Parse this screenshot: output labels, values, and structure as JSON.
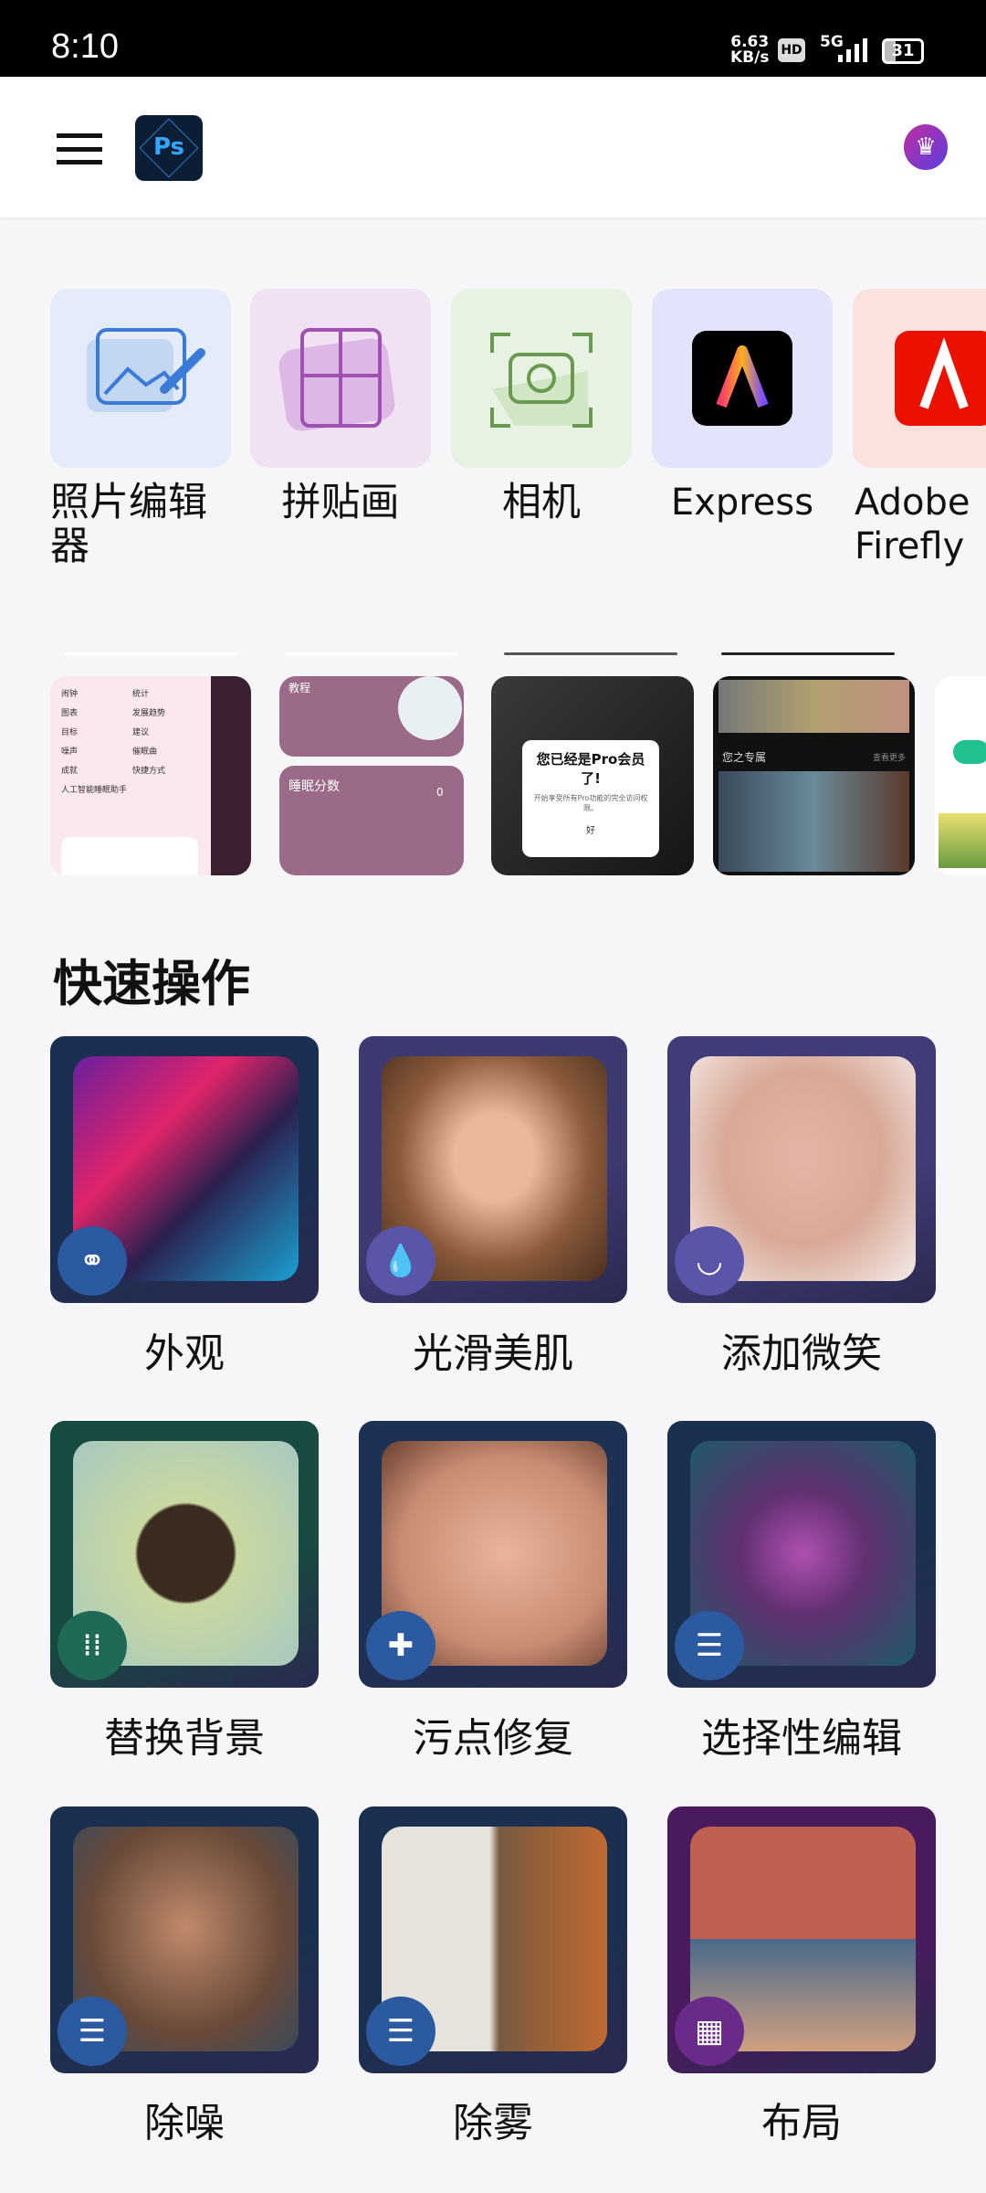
{
  "status_bar": {
    "time": "8:10",
    "net_speed": "6.63",
    "net_unit": "KB/s",
    "hd": "HD",
    "network": "5G",
    "battery": "31"
  },
  "header": {
    "logo_text": "Ps",
    "menu_icon": "hamburger-icon",
    "premium_icon": "crown-icon"
  },
  "apps": [
    {
      "label": "照片编辑器",
      "icon": "photo-edit-icon",
      "bg": "#e3ecf8"
    },
    {
      "label": "拼贴画",
      "icon": "collage-icon",
      "bg": "#f0e2f2"
    },
    {
      "label": "相机",
      "icon": "camera-icon",
      "bg": "#e8f2e2"
    },
    {
      "label": "Express",
      "icon": "adobe-express-icon",
      "bg": "#e3e3fb"
    },
    {
      "label": "Adobe Firefly",
      "icon": "adobe-firefly-icon",
      "bg": "#fbe2dd"
    }
  ],
  "recent": {
    "thumb1": {
      "items": [
        "闹钟",
        "统计",
        "图表",
        "发展趋势",
        "目标",
        "建议",
        "噪声",
        "催眠曲",
        "成就",
        "快捷方式",
        "人工智能睡眠助手"
      ]
    },
    "thumb2": {
      "title": "教程",
      "score": "睡眠分数",
      "score_value": "0"
    },
    "thumb3": {
      "dialog_title": "您已经是Pro会员了!",
      "dialog_body": "开始享受所有Pro功能的完全访问权限。",
      "dialog_ok": "好"
    },
    "thumb4": {
      "section": "您之专属",
      "more": "查看更多"
    }
  },
  "quick_actions": {
    "title": "快速操作",
    "items": [
      {
        "label": "外观",
        "icon": "venn-circles-icon",
        "frame": "#1b2f52",
        "accent": "#2b5aa0",
        "img": "linear-gradient(135deg,#6a1fa0,#e0246a 35%,#2a2050 60%,#1aa0d0)"
      },
      {
        "label": "光滑美肌",
        "icon": "droplet-icon",
        "frame": "#3d3a72",
        "accent": "#5a55a8",
        "img": "radial-gradient(ellipse at 50% 45%,#e8b898 25%,#8a5a3a 60%,#4a2e1e)"
      },
      {
        "label": "添加微笑",
        "icon": "smile-icon",
        "frame": "#403c78",
        "accent": "#5a55a8",
        "img": "radial-gradient(ellipse at 50% 45%,#e6b4a6,#d9a898 50%,#f3ece8)"
      },
      {
        "label": "替换背景",
        "icon": "dots-pattern-icon",
        "frame": "#174a40",
        "accent": "#1e6a56",
        "img": "radial-gradient(circle at 50% 50%,#3a2a20 30%,#c8d8a0 32%,#a8c8c0)"
      },
      {
        "label": "污点修复",
        "icon": "bandage-icon",
        "frame": "#1d3155",
        "accent": "#2b5aa0",
        "img": "radial-gradient(ellipse at 55% 50%,#e8b49a,#c88c72 60%,#6a4030)"
      },
      {
        "label": "选择性编辑",
        "icon": "sliders-icon",
        "frame": "#1b3050",
        "accent": "#2b5aa0",
        "img": "radial-gradient(ellipse at 50% 50%,#b050b0,#603070 40%,#1e5a6a)"
      },
      {
        "label": "除噪",
        "icon": "sliders-icon",
        "frame": "#1b3050",
        "accent": "#2b5aa0",
        "img": "radial-gradient(ellipse at 50% 45%,#c08a6a,#6a4a3a 60%,#3a4a5a)"
      },
      {
        "label": "除雾",
        "icon": "sliders-icon",
        "frame": "#1b3050",
        "accent": "#2b5aa0",
        "img": "linear-gradient(90deg,#e6e2dc 48%,#7a5a40 52%,#c06a30)"
      },
      {
        "label": "布局",
        "icon": "layout-grid-icon",
        "frame": "#4a1a5e",
        "accent": "#6a2a8a",
        "img": "linear-gradient(180deg,#c06050 0,#c06050 50%,#4a6a8a 50%,#d0a080)"
      }
    ]
  }
}
